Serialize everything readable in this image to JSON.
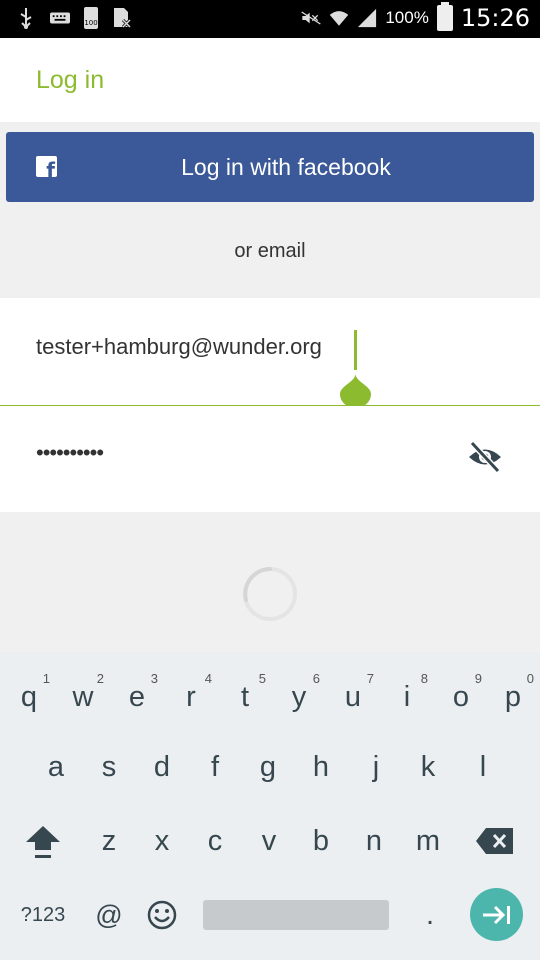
{
  "status_bar": {
    "battery_percent": "100%",
    "time": "15:26",
    "icons": [
      "usb-icon",
      "keyboard-icon",
      "battery-100-icon",
      "sim-disabled-icon",
      "mute-icon",
      "wifi-icon",
      "signal-icon",
      "battery-icon"
    ],
    "small_battery_text": "100"
  },
  "header": {
    "title": "Log in"
  },
  "facebook_button": {
    "label": "Log in with facebook",
    "icon": "facebook-icon",
    "color": "#3b5998"
  },
  "separator_text": "or email",
  "form": {
    "email_value": "tester+hamburg@wunder.org",
    "password_value": "••••••••••",
    "password_toggle_icon": "eye-off-icon"
  },
  "accent_color": "#8dbb2f",
  "keyboard": {
    "row1": [
      {
        "key": "q",
        "hint": "1"
      },
      {
        "key": "w",
        "hint": "2"
      },
      {
        "key": "e",
        "hint": "3"
      },
      {
        "key": "r",
        "hint": "4"
      },
      {
        "key": "t",
        "hint": "5"
      },
      {
        "key": "y",
        "hint": "6"
      },
      {
        "key": "u",
        "hint": "7"
      },
      {
        "key": "i",
        "hint": "8"
      },
      {
        "key": "o",
        "hint": "9"
      },
      {
        "key": "p",
        "hint": "0"
      }
    ],
    "row2": [
      "a",
      "s",
      "d",
      "f",
      "g",
      "h",
      "j",
      "k",
      "l"
    ],
    "row3": [
      "z",
      "x",
      "c",
      "v",
      "b",
      "n",
      "m"
    ],
    "shift_icon": "shift-icon",
    "delete_icon": "backspace-icon",
    "symbols_label": "?123",
    "at_label": "@",
    "emoji_icon": "emoji-icon",
    "period_label": ".",
    "enter_icon": "next-field-icon"
  }
}
